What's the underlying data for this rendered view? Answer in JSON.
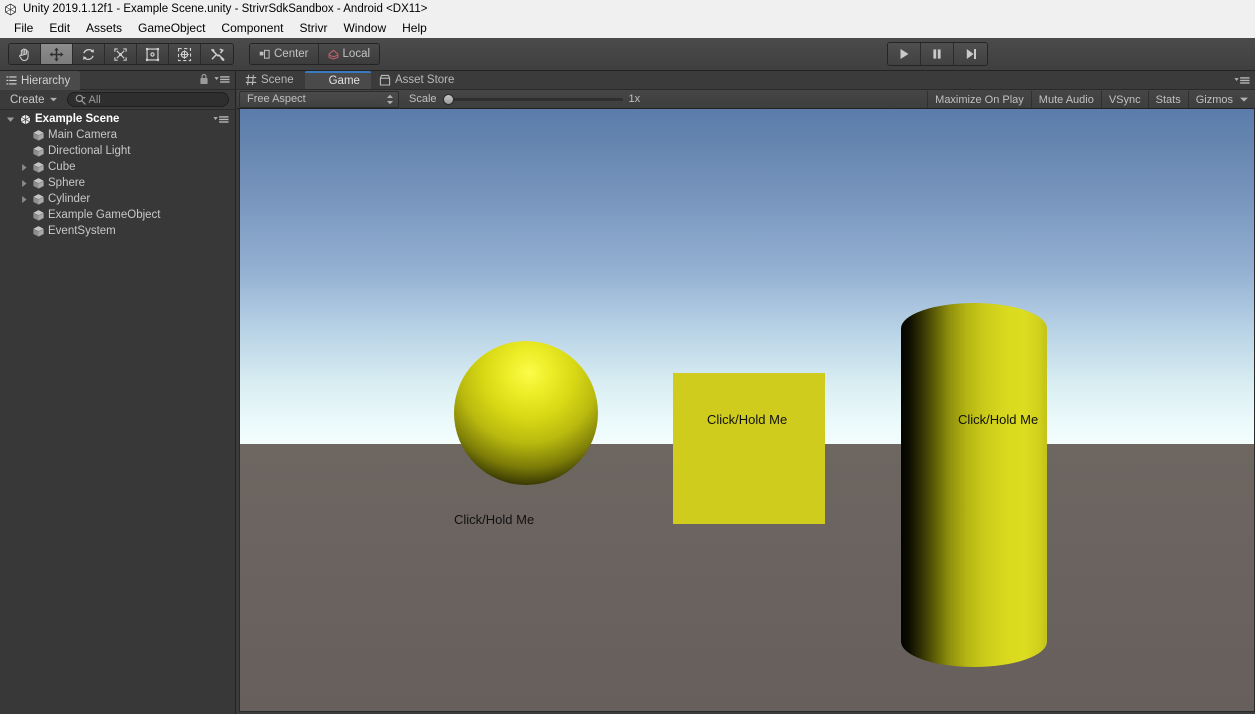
{
  "window": {
    "title": "Unity 2019.1.12f1 - Example Scene.unity - StrivrSdkSandbox - Android <DX11>",
    "logo_icon": "unity-logo-icon"
  },
  "menubar": {
    "items": [
      {
        "label": "File"
      },
      {
        "label": "Edit"
      },
      {
        "label": "Assets"
      },
      {
        "label": "GameObject"
      },
      {
        "label": "Component"
      },
      {
        "label": "Strivr"
      },
      {
        "label": "Window"
      },
      {
        "label": "Help"
      }
    ]
  },
  "toolbar": {
    "tools": [
      {
        "name": "hand-tool",
        "icon": "hand-icon",
        "active": false
      },
      {
        "name": "move-tool",
        "icon": "move-icon",
        "active": true
      },
      {
        "name": "rotate-tool",
        "icon": "rotate-icon",
        "active": false
      },
      {
        "name": "scale-tool",
        "icon": "scale-icon",
        "active": false
      },
      {
        "name": "rect-tool",
        "icon": "rect-transform-icon",
        "active": false
      },
      {
        "name": "transform-tool",
        "icon": "transform-icon",
        "active": false
      },
      {
        "name": "custom-editor-tool",
        "icon": "tools-icon",
        "active": false
      }
    ],
    "pivot_mode": "Center",
    "pivot_rotation": "Local",
    "play_controls": [
      {
        "name": "play-button",
        "icon": "play-icon"
      },
      {
        "name": "pause-button",
        "icon": "pause-icon"
      },
      {
        "name": "step-button",
        "icon": "step-icon"
      }
    ]
  },
  "hierarchy": {
    "tab_label": "Hierarchy",
    "tab_icon": "hierarchy-icon",
    "lock_icon": "lock-icon",
    "menu_icon": "hamburger-menu-icon",
    "create_label": "Create",
    "search_placeholder": "All",
    "search_value": "All",
    "scene": {
      "label": "Example Scene",
      "icon": "unity-scene-icon",
      "expanded": true
    },
    "items": [
      {
        "label": "Main Camera",
        "icon": "gameobject-icon",
        "has_children": false
      },
      {
        "label": "Directional Light",
        "icon": "gameobject-icon",
        "has_children": false
      },
      {
        "label": "Cube",
        "icon": "gameobject-icon",
        "has_children": true
      },
      {
        "label": "Sphere",
        "icon": "gameobject-icon",
        "has_children": true
      },
      {
        "label": "Cylinder",
        "icon": "gameobject-icon",
        "has_children": true
      },
      {
        "label": "Example GameObject",
        "icon": "gameobject-icon",
        "has_children": false
      },
      {
        "label": "EventSystem",
        "icon": "gameobject-icon",
        "has_children": false
      }
    ]
  },
  "gamepanel": {
    "tabs": [
      {
        "label": "Scene",
        "icon": "scene-icon",
        "active": false
      },
      {
        "label": "Game",
        "icon": "game-icon",
        "active": true
      },
      {
        "label": "Asset Store",
        "icon": "asset-store-icon",
        "active": false
      }
    ],
    "menu_icon": "hamburger-menu-icon",
    "aspect": "Free Aspect",
    "scale_label": "Scale",
    "scale_value": "1x",
    "scale_percent": 0,
    "right_buttons": [
      {
        "label": "Maximize On Play",
        "name": "maximize-on-play-toggle"
      },
      {
        "label": "Mute Audio",
        "name": "mute-audio-toggle"
      },
      {
        "label": "VSync",
        "name": "vsync-toggle"
      },
      {
        "label": "Stats",
        "name": "stats-toggle"
      },
      {
        "label": "Gizmos",
        "name": "gizmos-dropdown"
      }
    ]
  },
  "scene_objects": [
    {
      "name": "sphere-object",
      "label": "Click/Hold Me"
    },
    {
      "name": "cube-object",
      "label": "Click/Hold Me"
    },
    {
      "name": "cylinder-object",
      "label": "Click/Hold Me"
    }
  ],
  "colors": {
    "object_yellow": "#cfcc1e",
    "sky_top": "#5b7cab",
    "sky_horizon": "#ecfafb",
    "ground": "#6b6460",
    "panel_bg": "#383838",
    "toolbar_bg": "#4b4b4b",
    "accent_tab": "#3a79c4"
  }
}
